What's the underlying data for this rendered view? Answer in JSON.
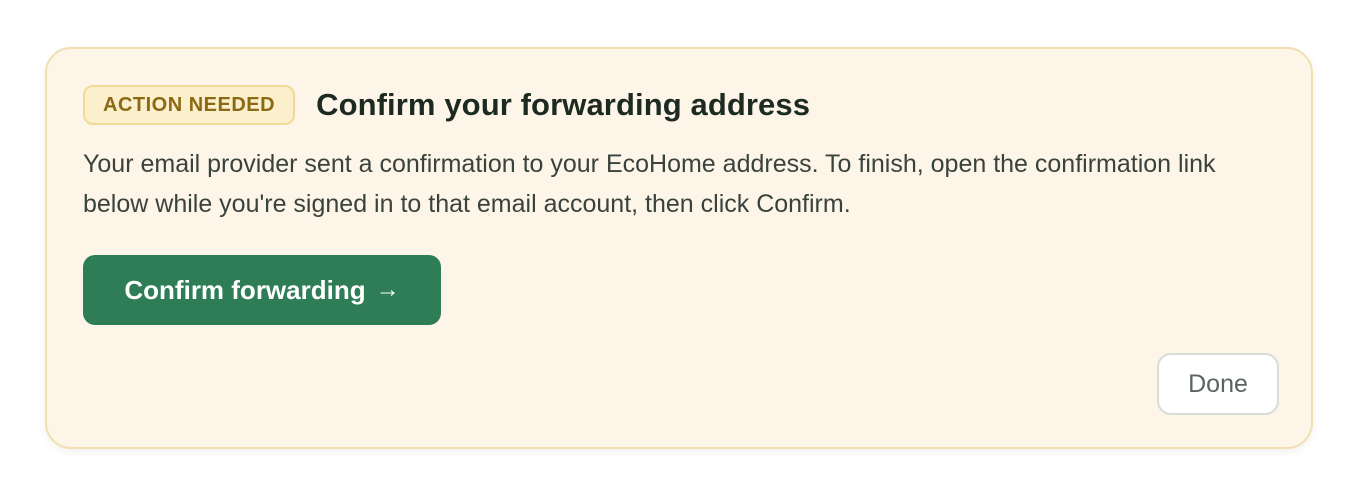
{
  "notice": {
    "badge_label": "ACTION NEEDED",
    "title": "Confirm your forwarding address",
    "description": "Your email provider sent a confirmation to your EcoHome address. To finish, open the confirmation link below while you're signed in to that email account, then click Confirm.",
    "confirm_button_label": "Confirm forwarding",
    "confirm_button_arrow": "→",
    "done_button_label": "Done"
  },
  "colors": {
    "card_background": "#fdf6e8",
    "card_border": "#f1dfb1",
    "badge_background": "#fcefcb",
    "badge_text": "#8b6a16",
    "primary_button": "#2e7d57",
    "title_text": "#1c2a22"
  },
  "icons": {
    "confirm_button_icon": "arrow-right-icon"
  }
}
